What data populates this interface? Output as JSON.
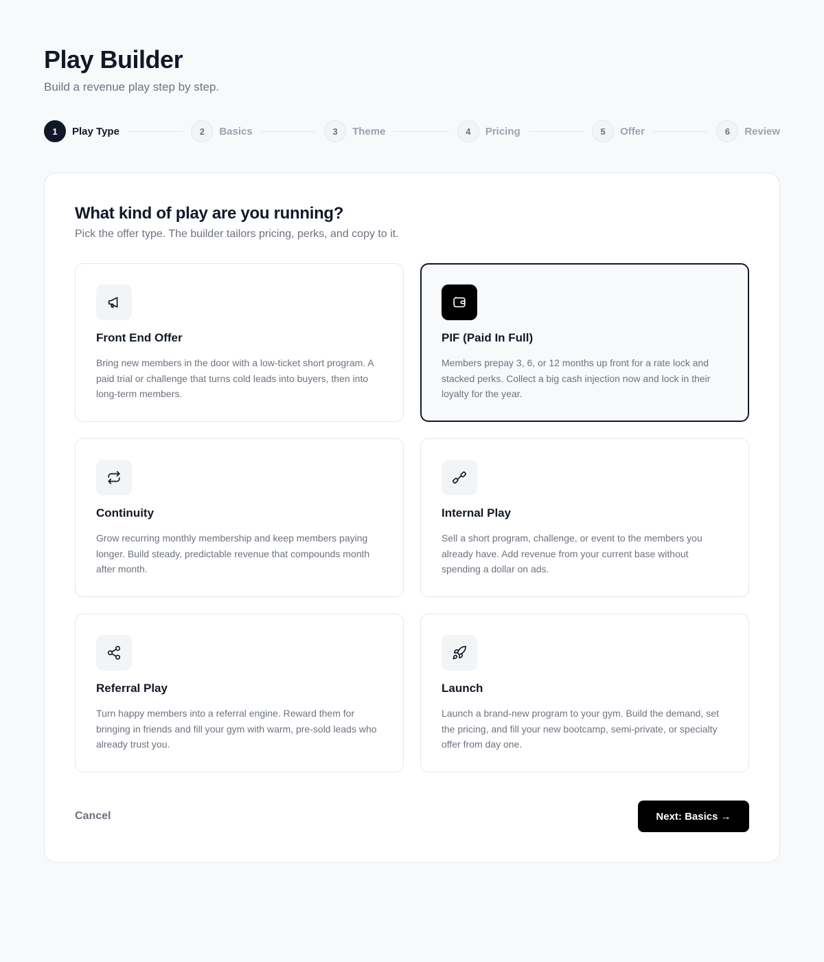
{
  "header": {
    "title": "Play Builder",
    "subtitle": "Build a revenue play step by step."
  },
  "stepper": {
    "steps": [
      {
        "number": "1",
        "label": "Play Type",
        "active": true
      },
      {
        "number": "2",
        "label": "Basics"
      },
      {
        "number": "3",
        "label": "Theme"
      },
      {
        "number": "4",
        "label": "Pricing"
      },
      {
        "number": "5",
        "label": "Offer"
      },
      {
        "number": "6",
        "label": "Review"
      }
    ]
  },
  "panel": {
    "title": "What kind of play are you running?",
    "subtitle": "Pick the offer type. The builder tailors pricing, perks, and copy to it.",
    "selected_option": "PIF (Paid In Full)",
    "options": [
      {
        "title": "Front End Offer",
        "icon": "megaphone-icon",
        "description": "Bring new members in the door with a low-ticket short program. A paid trial or challenge that turns cold leads into buyers, then into long-term members."
      },
      {
        "title": "PIF (Paid In Full)",
        "icon": "wallet-icon",
        "description": "Members prepay 3, 6, or 12 months up front for a rate lock and stacked perks. Collect a big cash injection now and lock in their loyalty for the year."
      },
      {
        "title": "Continuity",
        "icon": "repeat-icon",
        "description": "Grow recurring monthly membership and keep members paying longer. Build steady, predictable revenue that compounds month after month."
      },
      {
        "title": "Internal Play",
        "icon": "dumbbell-icon",
        "description": "Sell a short program, challenge, or event to the members you already have. Add revenue from your current base without spending a dollar on ads."
      },
      {
        "title": "Referral Play",
        "icon": "share-icon",
        "description": "Turn happy members into a referral engine. Reward them for bringing in friends and fill your gym with warm, pre-sold leads who already trust you."
      },
      {
        "title": "Launch",
        "icon": "rocket-icon",
        "description": "Launch a brand-new program to your gym. Build the demand, set the pricing, and fill your new bootcamp, semi-private, or specialty offer from day one."
      }
    ]
  },
  "footer": {
    "cancel_label": "Cancel",
    "next_label": "Next: Basics →"
  },
  "colors": {
    "accent": "#111827",
    "background": "#f8f9fb",
    "muted_text": "#6b7280"
  }
}
